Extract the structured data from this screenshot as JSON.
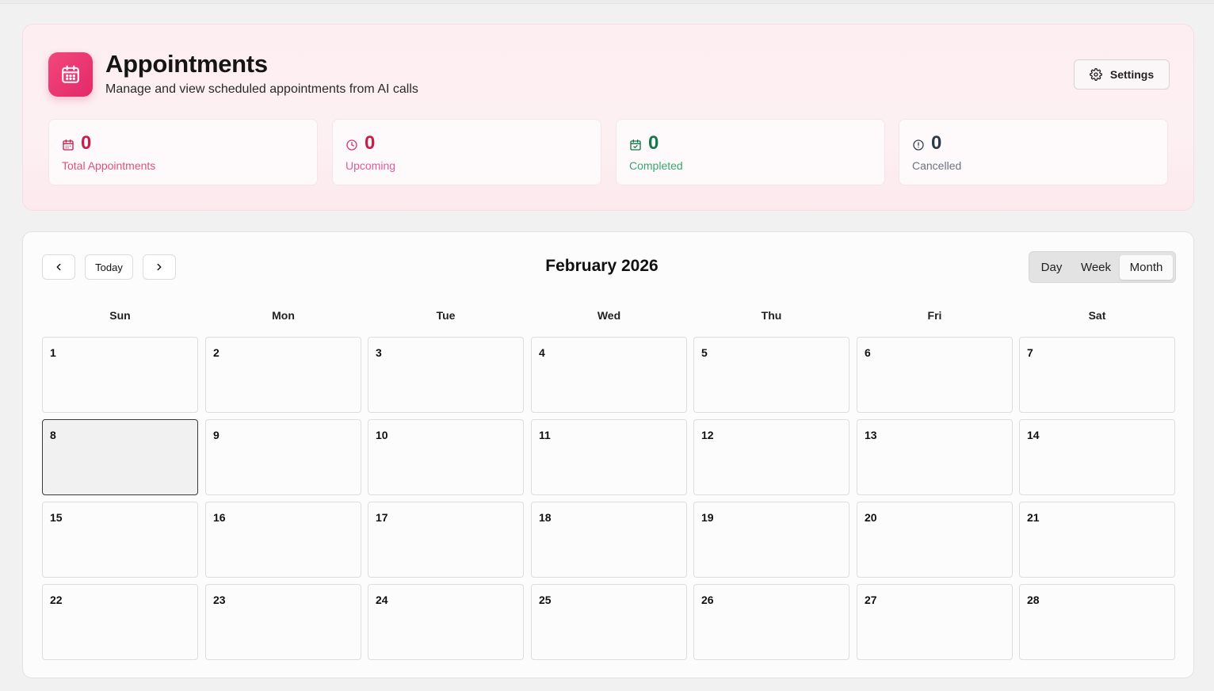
{
  "header": {
    "title": "Appointments",
    "subtitle": "Manage and view scheduled appointments from AI calls",
    "settings_label": "Settings"
  },
  "stats": [
    {
      "value": "0",
      "label": "Total Appointments",
      "color": "#c81e4a",
      "label_color": "#e05278"
    },
    {
      "value": "0",
      "label": "Upcoming",
      "color": "#c81e4a",
      "label_color": "#e05a9a"
    },
    {
      "value": "0",
      "label": "Completed",
      "color": "#16774a",
      "label_color": "#3aa56f"
    },
    {
      "value": "0",
      "label": "Cancelled",
      "color": "#2f3a48",
      "label_color": "#6b7280"
    }
  ],
  "calendar": {
    "today_label": "Today",
    "month_title": "February 2026",
    "views": [
      "Day",
      "Week",
      "Month"
    ],
    "active_view": "Month",
    "weekdays": [
      "Sun",
      "Mon",
      "Tue",
      "Wed",
      "Thu",
      "Fri",
      "Sat"
    ],
    "days": [
      "1",
      "2",
      "3",
      "4",
      "5",
      "6",
      "7",
      "8",
      "9",
      "10",
      "11",
      "12",
      "13",
      "14",
      "15",
      "16",
      "17",
      "18",
      "19",
      "20",
      "21",
      "22",
      "23",
      "24",
      "25",
      "26",
      "27",
      "28"
    ],
    "selected_day": "8"
  },
  "colors": {
    "accent": "#e8326f"
  }
}
